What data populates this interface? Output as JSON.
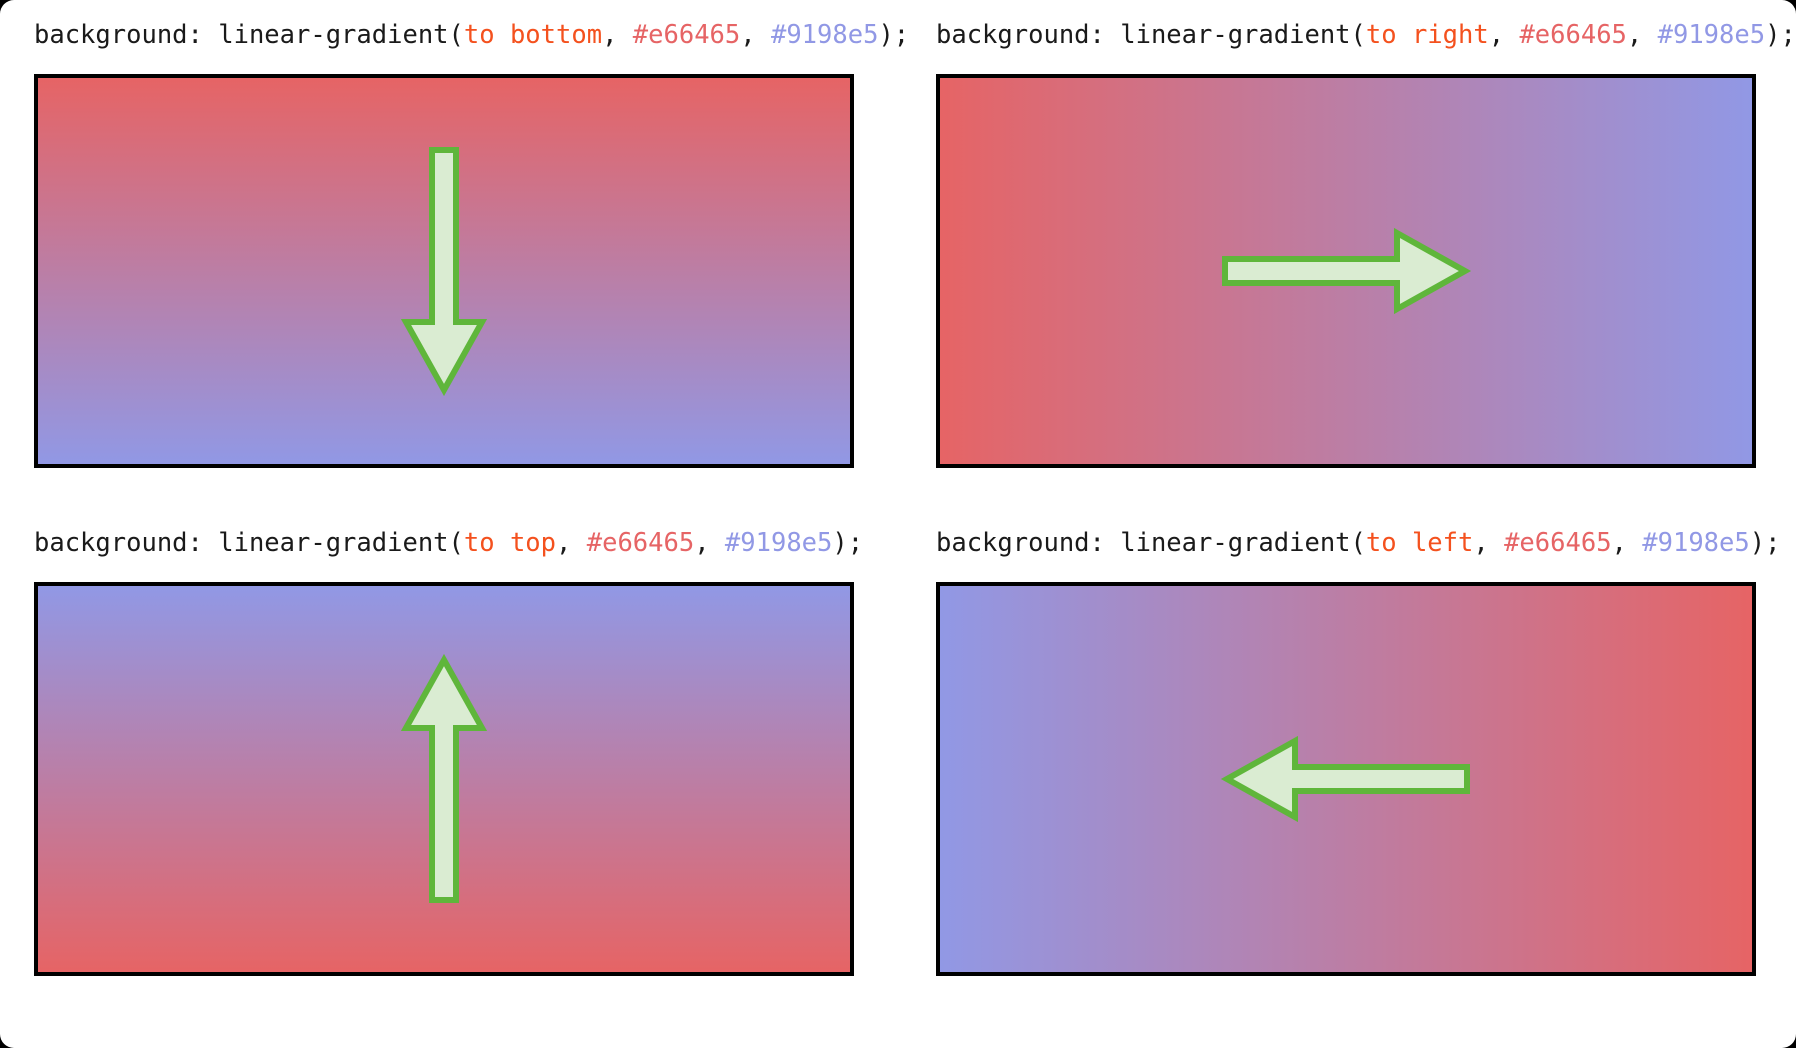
{
  "page": {
    "background": "#ffffff",
    "outer_background": "#000000",
    "corner_radius_px": 14
  },
  "theme": {
    "code_text": "#1a1a1a",
    "keyword_direction": "#f4511e",
    "color_token_1": "#e66465",
    "color_token_2": "#9198e5",
    "swatch_border": "#000000",
    "arrow_fill": "#daecd2",
    "arrow_stroke": "#5fb63b"
  },
  "gradient_colors": {
    "start": "#e66465",
    "end": "#9198e5"
  },
  "cells": [
    {
      "id": "to-bottom",
      "label": {
        "property": "background:",
        "function": " linear-gradient(",
        "direction": "to bottom",
        "sep1": ", ",
        "color1": "#e66465",
        "sep2": ", ",
        "color2": "#9198e5",
        "close": ");",
        "full": "background: linear-gradient(to bottom, #e66465, #9198e5);"
      },
      "direction": "to bottom",
      "arrow": "arrow-down-icon",
      "css_gradient": "linear-gradient(to bottom, #e66465, #9198e5)"
    },
    {
      "id": "to-right",
      "label": {
        "property": "background:",
        "function": " linear-gradient(",
        "direction": "to right",
        "sep1": ", ",
        "color1": "#e66465",
        "sep2": ", ",
        "color2": "#9198e5",
        "close": ");",
        "full": "background: linear-gradient(to right, #e66465, #9198e5);"
      },
      "direction": "to right",
      "arrow": "arrow-right-icon",
      "css_gradient": "linear-gradient(to right, #e66465, #9198e5)"
    },
    {
      "id": "to-top",
      "label": {
        "property": "background:",
        "function": " linear-gradient(",
        "direction": "to top",
        "sep1": ", ",
        "color1": "#e66465",
        "sep2": ", ",
        "color2": "#9198e5",
        "close": ");",
        "full": "background: linear-gradient(to top, #e66465, #9198e5);"
      },
      "direction": "to top",
      "arrow": "arrow-up-icon",
      "css_gradient": "linear-gradient(to top, #e66465, #9198e5)"
    },
    {
      "id": "to-left",
      "label": {
        "property": "background:",
        "function": " linear-gradient(",
        "direction": "to left",
        "sep1": ", ",
        "color1": "#e66465",
        "sep2": ", ",
        "color2": "#9198e5",
        "close": ");",
        "full": "background: linear-gradient(to left, #e66465, #9198e5);"
      },
      "direction": "to left",
      "arrow": "arrow-left-icon",
      "css_gradient": "linear-gradient(to left, #e66465, #9198e5)"
    }
  ]
}
